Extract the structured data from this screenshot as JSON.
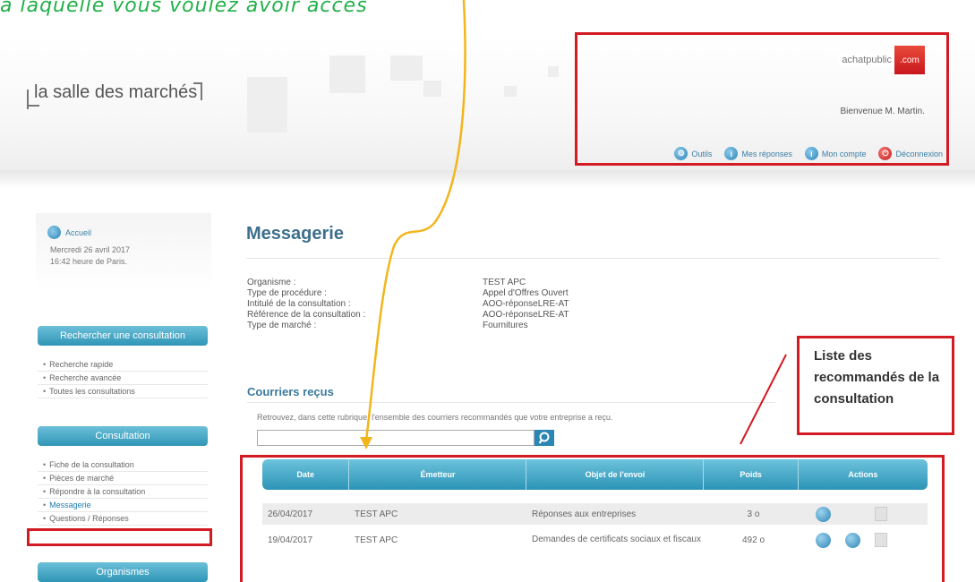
{
  "caption": "à laquelle vous voulez avoir accès",
  "header": {
    "logo": "la salle des marchés",
    "brand_name": "achatpublic",
    "brand_suffix": ".com",
    "welcome": "Bienvenue M. Martin.",
    "links": [
      {
        "label": "Outils",
        "icon": "tools-icon"
      },
      {
        "label": "Mes réponses",
        "icon": "responses-icon"
      },
      {
        "label": "Mon compte",
        "icon": "account-icon"
      },
      {
        "label": "Déconnexion",
        "icon": "power-icon"
      }
    ]
  },
  "sidebar": {
    "home_label": "Accueil",
    "date_line1": "Mercredi 26 avril 2017",
    "date_line2": "16:42 heure de Paris.",
    "section_search": {
      "title": "Rechercher une consultation",
      "items": [
        "Recherche rapide",
        "Recherche avancée",
        "Toutes les consultations"
      ]
    },
    "section_consultation": {
      "title": "Consultation",
      "items": [
        "Fiche de la consultation",
        "Pièces de marché",
        "Répondre à la consultation",
        "Messagerie",
        "Questions / Réponses"
      ]
    },
    "section_org": {
      "title": "Organismes"
    }
  },
  "main": {
    "title": "Messagerie",
    "info": [
      {
        "label": "Organisme :",
        "value": "TEST APC"
      },
      {
        "label": "Type de procédure :",
        "value": "Appel d'Offres Ouvert"
      },
      {
        "label": "Intitulé de la consultation :",
        "value": "AOO-réponseLRE-AT"
      },
      {
        "label": "Référence de la consultation :",
        "value": "AOO-réponseLRE-AT"
      },
      {
        "label": "Type de marché :",
        "value": "Fournitures"
      }
    ],
    "courriers_title": "Courriers reçus",
    "description": "Retrouvez, dans cette rubrique, l'ensemble des courriers recommandés que votre entreprise a reçu.",
    "search_placeholder": "",
    "table": {
      "headers": [
        "Date",
        "Émetteur",
        "Objet de l'envoi",
        "Poids",
        "Actions"
      ],
      "rows": [
        {
          "date": "26/04/2017",
          "sender": "TEST APC",
          "subject": "Réponses aux entreprises",
          "weight": "3 o"
        },
        {
          "date": "19/04/2017",
          "sender": "TEST APC",
          "subject": "Demandes de certificats sociaux et fiscaux",
          "weight": "492 o"
        }
      ]
    }
  },
  "callout": {
    "text": "Liste des recommandés de la consultation"
  },
  "colors": {
    "accent": "#2f95b6",
    "highlight": "#d31b24",
    "arrow": "#f2b51c",
    "caption": "#23b04a"
  }
}
